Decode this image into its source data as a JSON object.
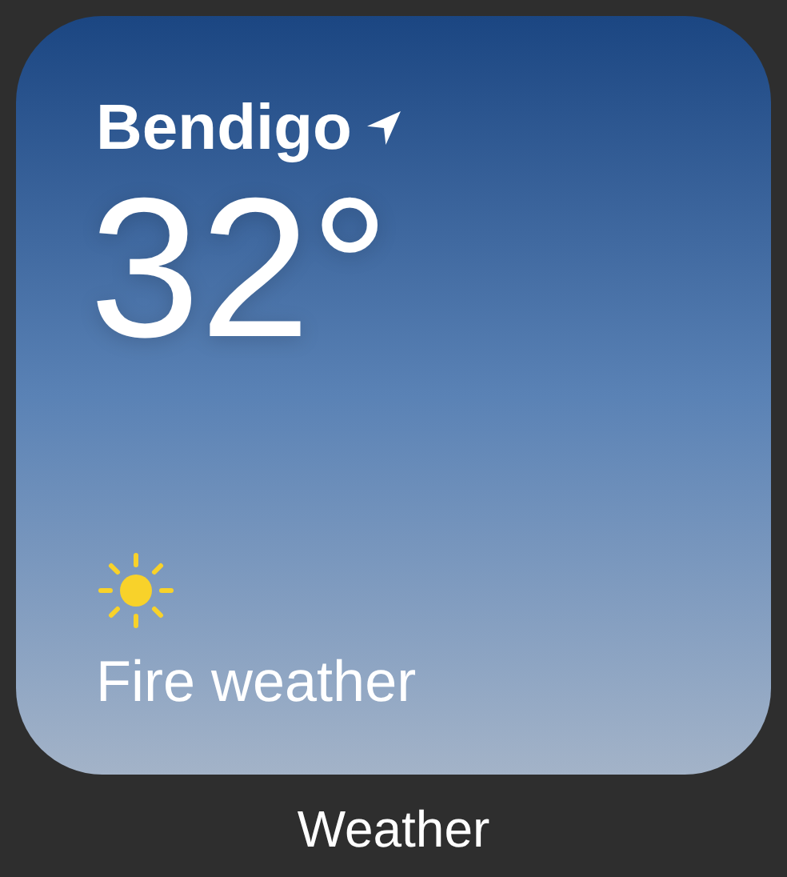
{
  "widget": {
    "location": "Bendigo",
    "current_location": true,
    "temperature": "32°",
    "condition": {
      "kind": "sunny",
      "label": "Fire weather"
    }
  },
  "app_label": "Weather"
}
